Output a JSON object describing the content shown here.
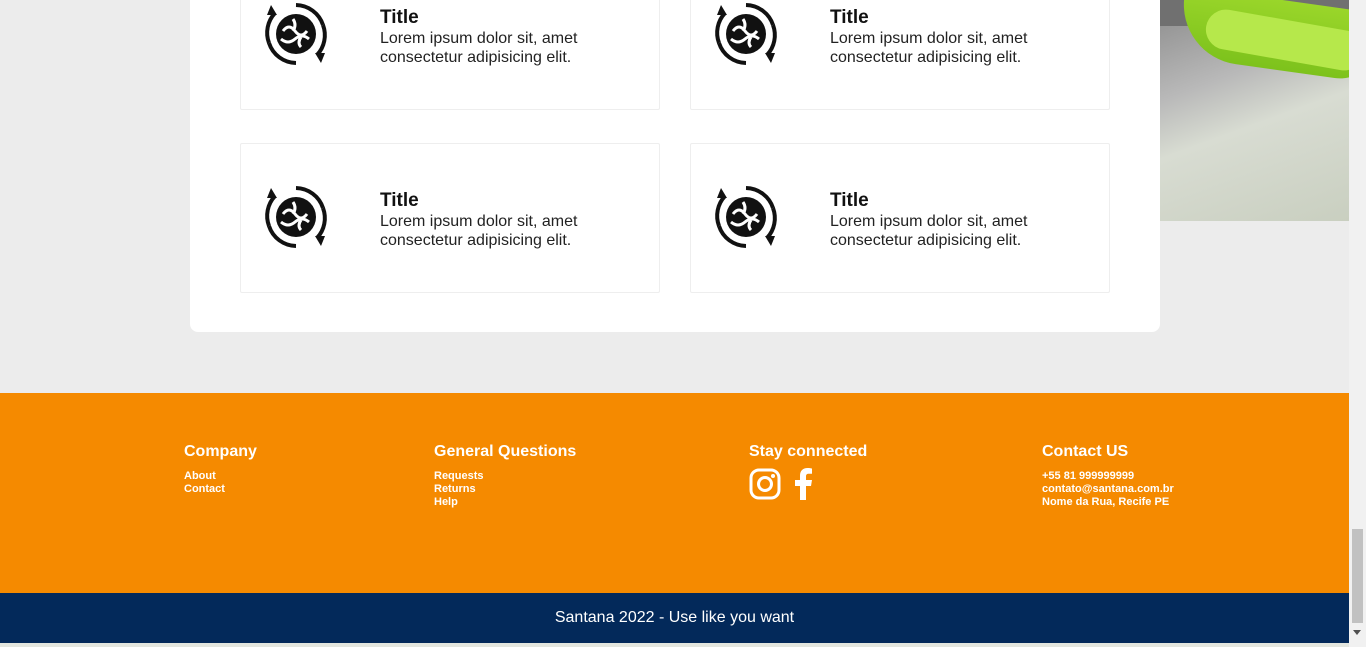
{
  "features": [
    {
      "title": "Title",
      "description": "Lorem ipsum dolor sit, amet consectetur adipisicing elit."
    },
    {
      "title": "Title",
      "description": "Lorem ipsum dolor sit, amet consectetur adipisicing elit."
    },
    {
      "title": "Title",
      "description": "Lorem ipsum dolor sit, amet consectetur adipisicing elit."
    },
    {
      "title": "Title",
      "description": "Lorem ipsum dolor sit, amet consectetur adipisicing elit."
    }
  ],
  "footer": {
    "company": {
      "heading": "Company",
      "links": [
        "About",
        "Contact"
      ]
    },
    "questions": {
      "heading": "General Questions",
      "links": [
        "Requests",
        "Returns",
        "Help"
      ]
    },
    "social": {
      "heading": "Stay connected",
      "icons": [
        "instagram-icon",
        "facebook-icon"
      ]
    },
    "contact": {
      "heading": "Contact US",
      "phone": "+55 81 999999999",
      "email": "contato@santana.com.br",
      "address": "Nome da Rua, Recife PE"
    },
    "copyright": "Santana 2022 - Use like you want"
  },
  "colors": {
    "footer_bg": "#f58a00",
    "bottom_bar_bg": "#03295a",
    "page_bg": "#ececec"
  }
}
